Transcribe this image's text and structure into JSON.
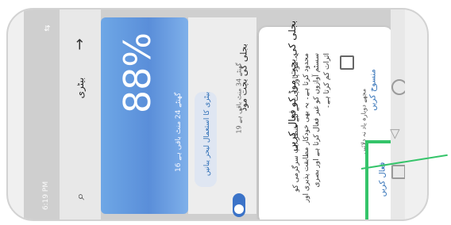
{
  "status_bar": {
    "time": "6:19 PM",
    "battery_label": "88%",
    "signal_icon": "signal-icon"
  },
  "appbar": {
    "title": "بیٹری"
  },
  "battery": {
    "percent": "88%",
    "remaining": "16 گھنٹے 24 منٹ باقی ہے"
  },
  "saver": {
    "title": "بجلی کی بچت موڈ",
    "subtitle": "19 گھنٹے 34 منٹ باقی ہے",
    "use_label": "بیٹری کا استعمال لیحر یبانیں"
  },
  "dialog": {
    "title": "بجلی کی بچت موڈ کو فعال کریں",
    "body": "یہ موڈ پاور بچت کے لیے منظر ایپ سرگرمی کو محدود کرتا ہے۔ یہ بھی خودکار مطابقت پذیری اور سسٹم آوازوں کو غیر فعال کرتا ہے اور بصری اثرات کم کرتا ہے۔",
    "checkbox_label": "مجھے دوبارہ یاد نہ دلائیں",
    "cancel_label": "منسوخ کریں",
    "activate_label": "فعال کریں"
  },
  "colors": {
    "accent": "#2f6fb6",
    "highlight": "#35c46a",
    "battery_card": "#5a8ed9"
  }
}
